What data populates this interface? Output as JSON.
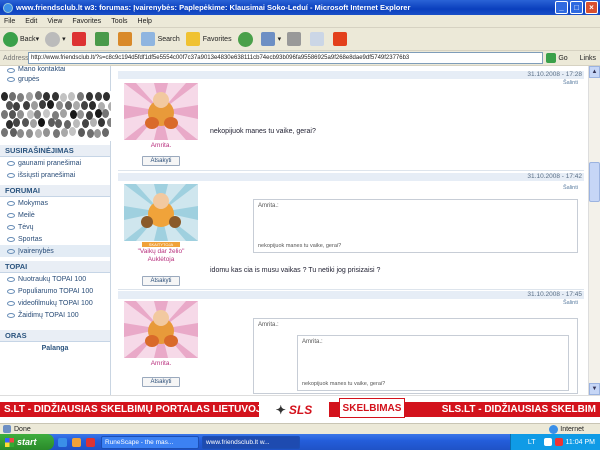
{
  "window": {
    "title": "www.friendsclub.lt w3: forumas: Įvairenybės: Paplepėkime: Klausimai Soko-Leduí - Microsoft Internet Explorer",
    "min": "_",
    "max": "□",
    "close": "×"
  },
  "menu": [
    "File",
    "Edit",
    "View",
    "Favorites",
    "Tools",
    "Help"
  ],
  "toolbar": {
    "back": "Back",
    "search": "Search",
    "favorites": "Favorites"
  },
  "address": {
    "label": "Address",
    "url": "http://www.friendsclub.lt/?s=c8c9c194d5fdf1df5e5554c00f7c37a9013e4830e638111cb74ecb93b096fa95586925a9f268e8dae9df5749f23776b3",
    "go": "Go",
    "links": "Links"
  },
  "sidebar": {
    "top_items": [
      "Mano kontaktai",
      "grupės"
    ],
    "sections": [
      {
        "title": "SUSIRAŠINĖJIMAS",
        "items": [
          "gaunami pranešimai",
          "išsiųsti pranešimai"
        ]
      },
      {
        "title": "FORUMAI",
        "items": [
          "Mokymas",
          "Meilė",
          "Tėvų",
          "Sportas",
          "Įvairenybės"
        ]
      },
      {
        "title": "TOPAI",
        "items": [
          "Nuotraukų TOPAI 100",
          "Populiarumo TOPAI 100",
          "videofilmukų TOPAI 100",
          "Žaidimų TOPAI 100"
        ]
      },
      {
        "title": "ORAS",
        "items": []
      }
    ],
    "weather_city": "Palanga"
  },
  "posts": [
    {
      "date": "31.10.2008 - 17:28",
      "action": "Šalinti",
      "user": "Amrita.",
      "reply": "Atsakyti",
      "text": "nekopijuok manes tu vaike, gerai?"
    },
    {
      "date": "31.10.2008 - 17:42",
      "action": "Šalinti",
      "user": "\"Vaikų dar želio\" Auklėtoja",
      "rank": "SKAITYTOJA",
      "reply": "Atsakyti",
      "quote_author": "Amrita.:",
      "quote_text": "nekopijuok manes tu vaike, gerai?",
      "text": "idomu kas cia is musu vaikas ? Tu netiki jog prisizaisi ?"
    },
    {
      "date": "31.10.2008 - 17:45",
      "action": "Šalinti",
      "user": "Amrita.",
      "reply": "Atsakyti",
      "quote_author": "Amrita.:",
      "inner_quote_author": "Amrita.:",
      "inner_quote_text": "nekopijuok manes tu vaike, gerai?"
    }
  ],
  "banner": {
    "left": "S.LT - DIDŽIAUSIAS SKELBIMŲ PORTALAS LIETUVOJE",
    "logo1": "SLS",
    "logo2": "SKELBIMAS",
    "right": "SLS.LT - DIDŽIAUSIAS SKELBIM"
  },
  "status": {
    "text": "Done",
    "zone": "Internet"
  },
  "taskbar": {
    "start": "start",
    "tasks": [
      "RuneScape - the mas...",
      "www.friendsclub.lt w..."
    ],
    "lang": "LT",
    "time": "11:04 PM"
  }
}
